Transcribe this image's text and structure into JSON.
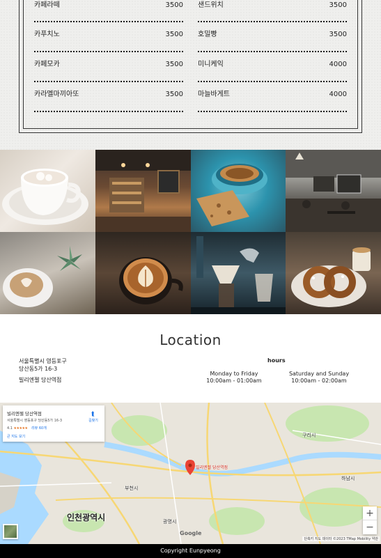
{
  "menu": {
    "left": [
      {
        "name": "카페라떼",
        "price": "3500"
      },
      {
        "name": "카푸치노",
        "price": "3500"
      },
      {
        "name": "카페모카",
        "price": "3500"
      },
      {
        "name": "카라멜마끼아또",
        "price": "3500"
      }
    ],
    "right": [
      {
        "name": "샌드위치",
        "price": "3500"
      },
      {
        "name": "호밀빵",
        "price": "3500"
      },
      {
        "name": "미니케익",
        "price": "4000"
      },
      {
        "name": "마늘바게트",
        "price": "4000"
      }
    ]
  },
  "gallery": {
    "images": [
      {
        "icon": "cappuccino-cup-photo"
      },
      {
        "icon": "cafe-interior-photo"
      },
      {
        "icon": "coffee-and-biscotti-photo"
      },
      {
        "icon": "cafe-hall-photo"
      },
      {
        "icon": "latte-art-succulent-photo"
      },
      {
        "icon": "latte-art-cup-photo"
      },
      {
        "icon": "pour-over-coffee-photo"
      },
      {
        "icon": "pretzel-and-coffee-photo"
      }
    ]
  },
  "location": {
    "title": "Location",
    "address_line1": "서울특별시 영등포구",
    "address_line2": "당산동5가 16-3",
    "place_name": "빌리엔젤 당산역점",
    "hours_label": "hours",
    "weekday_label": "Monday to Friday",
    "weekday_time": "10:00am - 01:00am",
    "weekend_label": "Saturday and Sunday",
    "weekend_time": "10:00am - 02:00am"
  },
  "map": {
    "card_title": "빌리엔젤 당산역점",
    "card_address": "서울특별시 영등포구 당산동5가 16-3",
    "rating": "4.1",
    "stars": "★★★★★",
    "reviews": "리뷰 60개",
    "larger_map": "큰 지도 보기",
    "directions": "길찾기",
    "pin_label": "빌리엔젤 당산역점",
    "cities": {
      "incheon": "인천광역시",
      "bucheon": "부천시",
      "gwangmyeong": "광명시",
      "hanam": "하남시",
      "guri": "구리시"
    },
    "google": "Google",
    "attribution": "단축키  지도 데이터 ©2023 TMap Mobility  약관",
    "zoom_in": "+",
    "zoom_out": "−",
    "colors": {
      "water": "#aadaff",
      "park": "#c8e6b0",
      "road": "#f7d774",
      "pin": "#ea4335"
    }
  },
  "footer": {
    "copyright": "Copyright Eunpyeong"
  }
}
